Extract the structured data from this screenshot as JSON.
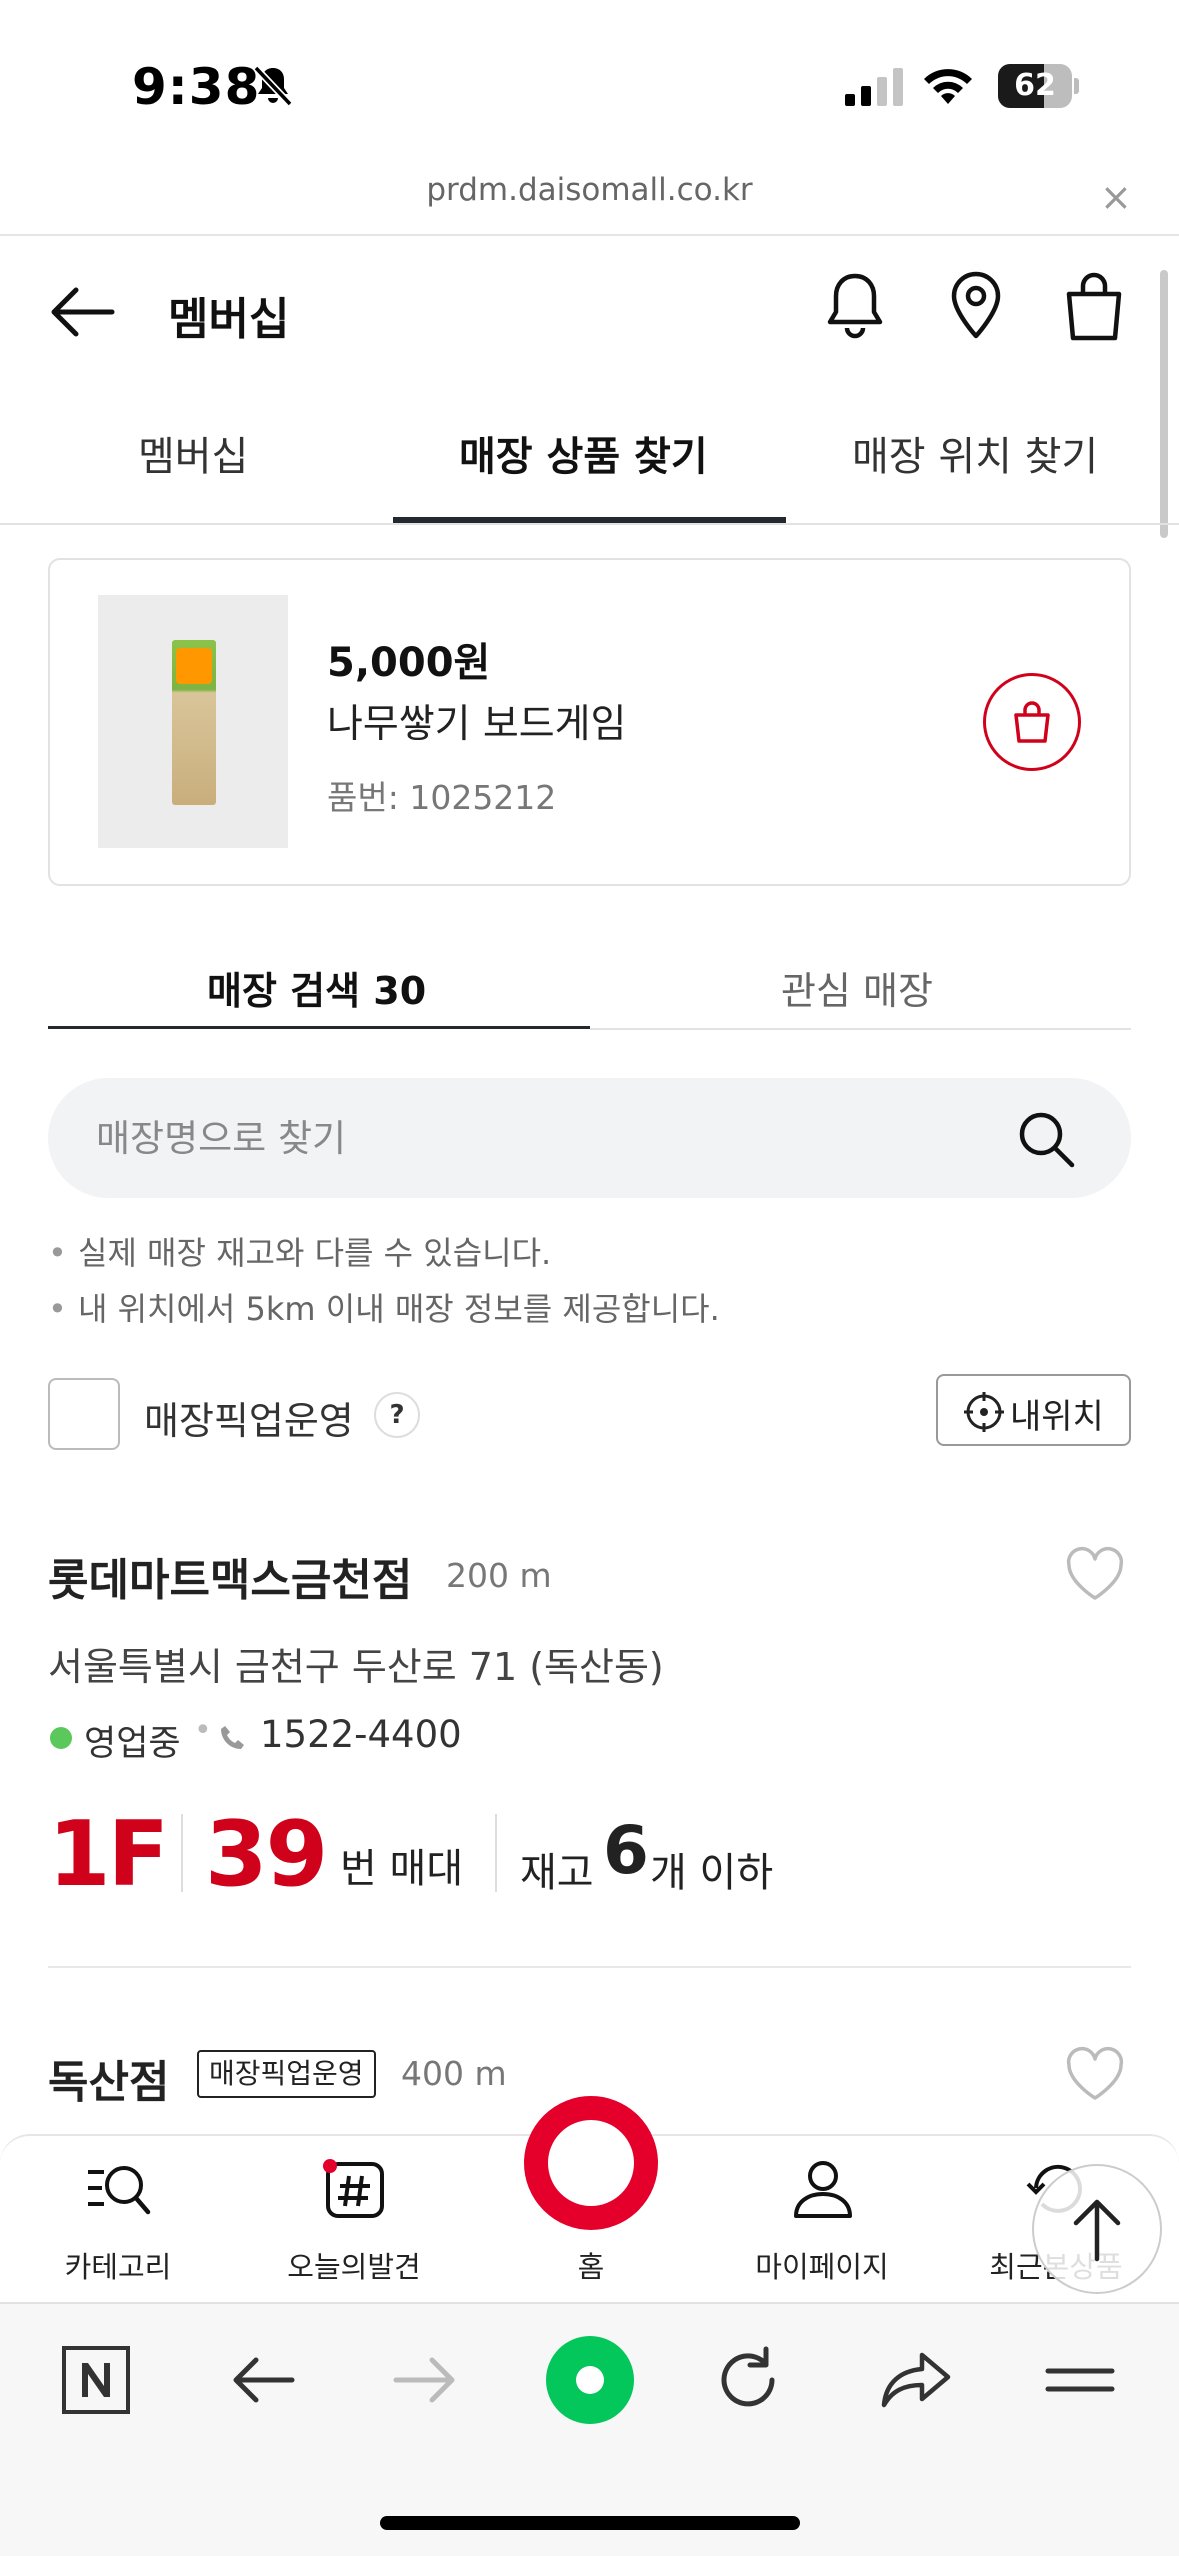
{
  "status_bar": {
    "time": "9:38",
    "battery": "62",
    "battery_level": 0.62,
    "icons": [
      "bell-slash-icon",
      "signal-icon",
      "wifi-icon",
      "battery-icon"
    ]
  },
  "browser": {
    "url": "prdm.daisomall.co.kr",
    "close": "×"
  },
  "header": {
    "title": "멤버십"
  },
  "main_tabs": [
    {
      "label": "멤버십",
      "active": false
    },
    {
      "label": "매장 상품 찾기",
      "active": true
    },
    {
      "label": "매장 위치 찾기",
      "active": false
    }
  ],
  "product": {
    "price": "5,000원",
    "name": "나무쌓기 보드게임",
    "code": "품번: 1025212"
  },
  "sub_tabs": [
    {
      "label": "매장 검색 30",
      "active": true
    },
    {
      "label": "관심 매장",
      "active": false
    }
  ],
  "search": {
    "placeholder": "매장명으로 찾기",
    "value": ""
  },
  "notes": [
    "실제 매장 재고와 다를 수 있습니다.",
    "내 위치에서 5km 이내 매장 정보를 제공합니다."
  ],
  "note_bullet": "•",
  "filter": {
    "pickup_label": "매장픽업운영",
    "help": "?",
    "checked": false,
    "my_location": "내위치"
  },
  "stores": [
    {
      "name": "롯데마트맥스금천점",
      "distance": "200 m",
      "address": "서울특별시 금천구 두산로 71 (독산동)",
      "status": "영업중",
      "separator": "•",
      "phone": "1522-4400",
      "floor": "1F",
      "aisle": "39",
      "aisle_unit": "번 매대",
      "stock_label": "재고",
      "stock_count": "6",
      "stock_unit": "개 이하",
      "favorite": false
    },
    {
      "name": "독산점",
      "badge": "매장픽업운영",
      "distance": "400 m",
      "favorite": false
    }
  ],
  "app_nav": [
    {
      "label": "카테고리",
      "icon": "category-search-icon"
    },
    {
      "label": "오늘의발견",
      "icon": "hashtag-icon"
    },
    {
      "label": "홈",
      "icon": "home-ring-icon"
    },
    {
      "label": "마이페이지",
      "icon": "person-icon"
    },
    {
      "label": "최근본상품",
      "icon": "recent-icon"
    }
  ],
  "browser_toolbar": [
    "naver-n-icon",
    "back-arrow-icon",
    "forward-arrow-icon",
    "green-dot-icon",
    "reload-icon",
    "share-icon",
    "menu-icon"
  ],
  "colors": {
    "accent": "#d0021b",
    "home_ring": "#e4002b",
    "open_status": "#5ac85a",
    "green_browser": "#03c75a"
  }
}
